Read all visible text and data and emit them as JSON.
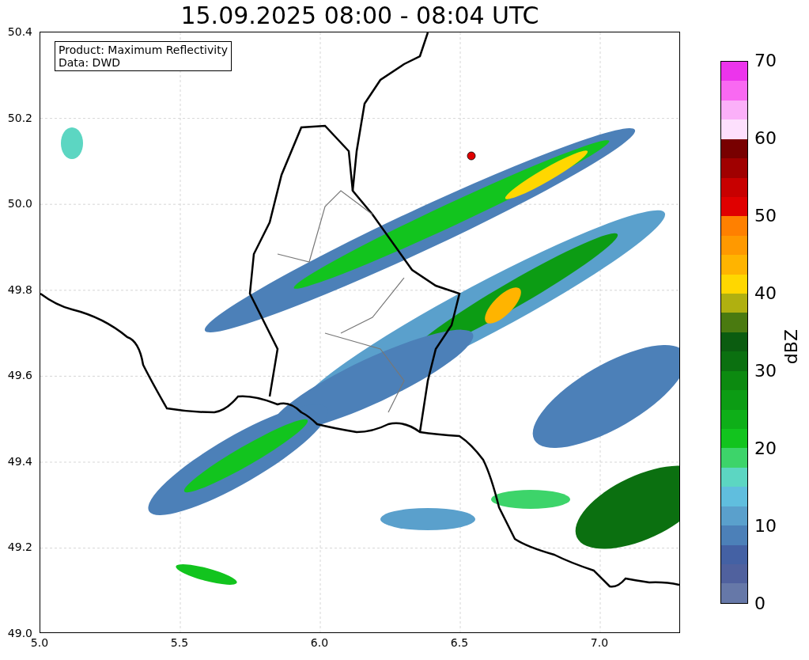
{
  "title": "15.09.2025 08:00 - 08:04 UTC",
  "map": {
    "info_lines": [
      "Product: Maximum Reflectivity",
      "Data: DWD"
    ],
    "yticks": [
      "50.4",
      "50.2",
      "50.0",
      "49.8",
      "49.6",
      "49.4",
      "49.2",
      "49.0"
    ],
    "xticks": [
      "5.0",
      "5.5",
      "6.0",
      "6.5",
      "7.0"
    ]
  },
  "colorbar": {
    "label": "dBZ",
    "ticks": [
      "70",
      "60",
      "50",
      "40",
      "30",
      "20",
      "10",
      "0"
    ],
    "bands": [
      {
        "color": "#ec34ec"
      },
      {
        "color": "#f969f2"
      },
      {
        "color": "#fbb0f9"
      },
      {
        "color": "#fde0fd"
      },
      {
        "color": "#780000"
      },
      {
        "color": "#a00000"
      },
      {
        "color": "#c80000"
      },
      {
        "color": "#e00000"
      },
      {
        "color": "#ff8000"
      },
      {
        "color": "#ff9900"
      },
      {
        "color": "#ffb400"
      },
      {
        "color": "#ffd700"
      },
      {
        "color": "#b0b010"
      },
      {
        "color": "#4a7a10"
      },
      {
        "color": "#0b5c10"
      },
      {
        "color": "#0b7010"
      },
      {
        "color": "#0c8a10"
      },
      {
        "color": "#0c9c14"
      },
      {
        "color": "#0eaf18"
      },
      {
        "color": "#12c41e"
      },
      {
        "color": "#3dd46a"
      },
      {
        "color": "#5cd6c2"
      },
      {
        "color": "#60bede"
      },
      {
        "color": "#5aa0cc"
      },
      {
        "color": "#4c80b8"
      },
      {
        "color": "#4461a4"
      },
      {
        "color": "#50619e"
      },
      {
        "color": "#6678a8"
      }
    ]
  }
}
